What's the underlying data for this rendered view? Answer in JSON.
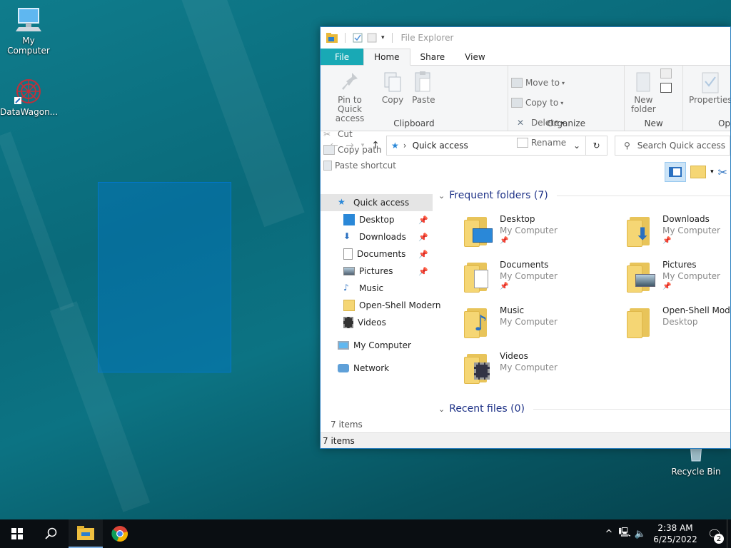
{
  "desktop": {
    "icons": [
      {
        "label": "My Computer"
      },
      {
        "label": "DataWagon..."
      },
      {
        "label": "Recycle Bin"
      }
    ]
  },
  "explorer": {
    "title": "File Explorer",
    "tabs": [
      "File",
      "Home",
      "Share",
      "View"
    ],
    "ribbon": {
      "clipboard": {
        "label": "Clipboard",
        "pin": "Pin to Quick access",
        "copy": "Copy",
        "paste": "Paste",
        "cut": "Cut",
        "copy_path": "Copy path",
        "paste_shortcut": "Paste shortcut"
      },
      "organize": {
        "label": "Organize",
        "move_to": "Move to",
        "copy_to": "Copy to",
        "delete": "Delete",
        "rename": "Rename"
      },
      "new": {
        "label": "New",
        "new_folder": "New folder"
      },
      "open": {
        "label": "Op",
        "properties": "Properties"
      }
    },
    "address": {
      "path": "Quick access",
      "search_placeholder": "Search Quick access"
    },
    "nav": {
      "quick_access": "Quick access",
      "items": [
        {
          "label": "Desktop",
          "pinned": true
        },
        {
          "label": "Downloads",
          "pinned": true
        },
        {
          "label": "Documents",
          "pinned": true
        },
        {
          "label": "Pictures",
          "pinned": true
        },
        {
          "label": "Music",
          "pinned": false
        },
        {
          "label": "Open-Shell Modern",
          "pinned": false
        },
        {
          "label": "Videos",
          "pinned": false
        }
      ],
      "my_computer": "My Computer",
      "network": "Network"
    },
    "frequent": {
      "heading": "Frequent folders (7)",
      "folders": [
        {
          "name": "Desktop",
          "location": "My Computer",
          "pinned": true
        },
        {
          "name": "Downloads",
          "location": "My Computer",
          "pinned": true
        },
        {
          "name": "Documents",
          "location": "My Computer",
          "pinned": true
        },
        {
          "name": "Pictures",
          "location": "My Computer",
          "pinned": true
        },
        {
          "name": "Music",
          "location": "My Computer",
          "pinned": false
        },
        {
          "name": "Open-Shell Modern",
          "location": "Desktop",
          "pinned": false
        },
        {
          "name": "Videos",
          "location": "My Computer",
          "pinned": false
        }
      ]
    },
    "recent": {
      "heading": "Recent files (0)"
    },
    "items_count": "7 items",
    "status": "7 items"
  },
  "taskbar": {
    "time": "2:38 AM",
    "date": "6/25/2022",
    "notification_count": "2"
  },
  "colors": {
    "accent": "#0078d7",
    "file_tab": "#19a9b5",
    "taskbar": "#0a0e12"
  }
}
